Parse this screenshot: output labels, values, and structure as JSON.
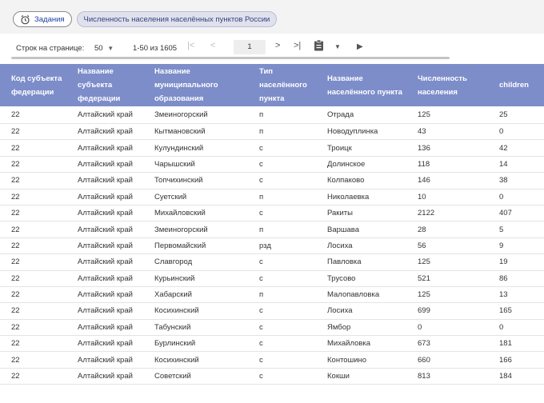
{
  "tabs": [
    {
      "label": "Задания",
      "icon": "alarm-clock-icon"
    },
    {
      "label": "Численность населения населённых пунктов России"
    }
  ],
  "toolbar": {
    "rows_per_page_label": "Строк на странице:",
    "rows_per_page_value": "50",
    "range_text": "1-50 из 1605",
    "page_value": "1"
  },
  "table": {
    "headers": [
      "Код субъекта федерации",
      "Название субъекта федерации",
      "Название муниципального образования",
      "Тип населённого пункта",
      "Название населённого пункта",
      "Численность населения",
      "children"
    ],
    "rows": [
      [
        "22",
        "Алтайский край",
        "Змеиногорский",
        "п",
        "Отрада",
        "125",
        "25"
      ],
      [
        "22",
        "Алтайский край",
        "Кытмановский",
        "п",
        "Новодуплинка",
        "43",
        "0"
      ],
      [
        "22",
        "Алтайский край",
        "Кулундинский",
        "с",
        "Троицк",
        "136",
        "42"
      ],
      [
        "22",
        "Алтайский край",
        "Чарышский",
        "с",
        "Долинское",
        "118",
        "14"
      ],
      [
        "22",
        "Алтайский край",
        "Топчихинский",
        "с",
        "Колпаково",
        "146",
        "38"
      ],
      [
        "22",
        "Алтайский край",
        "Суетский",
        "п",
        "Николаевка",
        "10",
        "0"
      ],
      [
        "22",
        "Алтайский край",
        "Михайловский",
        "с",
        "Ракиты",
        "2122",
        "407"
      ],
      [
        "22",
        "Алтайский край",
        "Змеиногорский",
        "п",
        "Варшава",
        "28",
        "5"
      ],
      [
        "22",
        "Алтайский край",
        "Первомайский",
        "рзд",
        "Лосиха",
        "56",
        "9"
      ],
      [
        "22",
        "Алтайский край",
        "Славгород",
        "с",
        "Павловка",
        "125",
        "19"
      ],
      [
        "22",
        "Алтайский край",
        "Курьинский",
        "с",
        "Трусово",
        "521",
        "86"
      ],
      [
        "22",
        "Алтайский край",
        "Хабарский",
        "п",
        "Малопавловка",
        "125",
        "13"
      ],
      [
        "22",
        "Алтайский край",
        "Косихинский",
        "с",
        "Лосиха",
        "699",
        "165"
      ],
      [
        "22",
        "Алтайский край",
        "Табунский",
        "с",
        "Ямбор",
        "0",
        "0"
      ],
      [
        "22",
        "Алтайский край",
        "Бурлинский",
        "с",
        "Михайловка",
        "673",
        "181"
      ],
      [
        "22",
        "Алтайский край",
        "Косихинский",
        "с",
        "Контошино",
        "660",
        "166"
      ],
      [
        "22",
        "Алтайский край",
        "Советский",
        "с",
        "Кокши",
        "813",
        "184"
      ]
    ]
  }
}
